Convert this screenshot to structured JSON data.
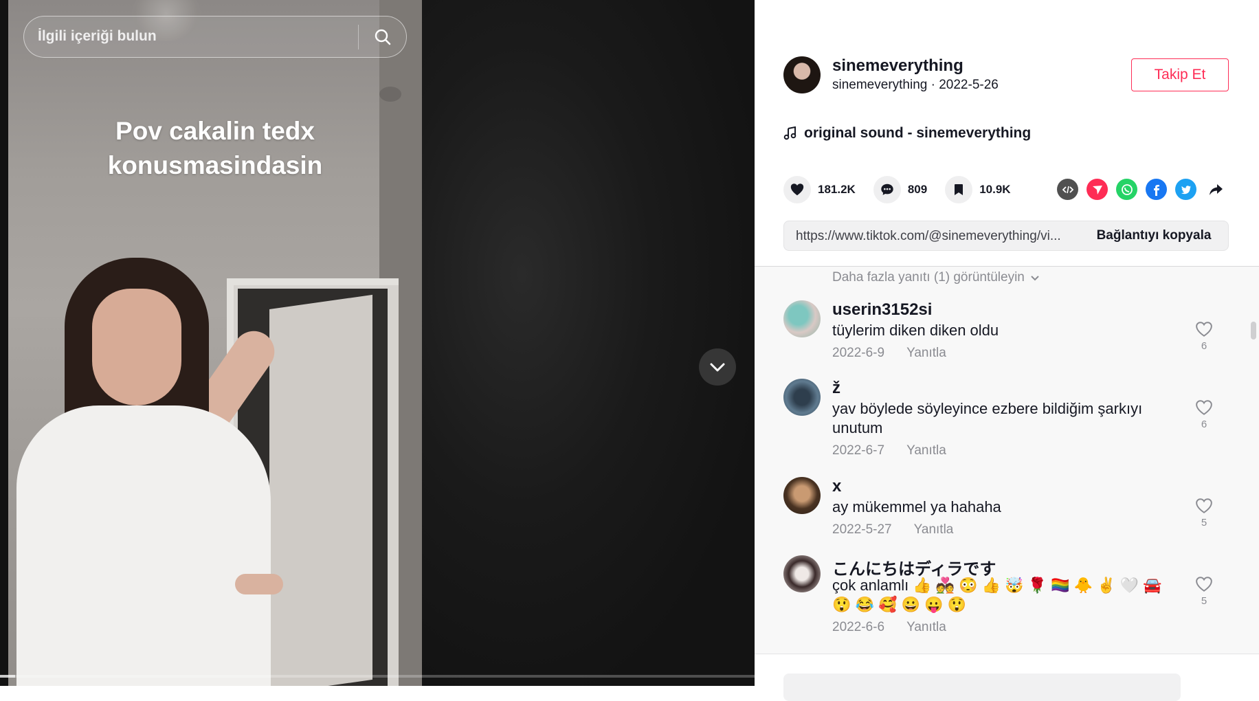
{
  "search": {
    "placeholder": "İlgili içeriği bulun"
  },
  "video": {
    "caption": "Pov cakalin tedx konusmasindasin",
    "progress": 0.02
  },
  "author": {
    "username": "sinemeverything",
    "display_name": "sinemeverything",
    "date": "2022-5-26",
    "meta_separator": " · "
  },
  "follow_label": "Takip Et",
  "sound": {
    "label": "original sound - sinemeverything"
  },
  "actions": {
    "likes": "181.2K",
    "comments": "809",
    "bookmarks": "10.9K"
  },
  "share_icons": [
    "embed-icon",
    "send-icon",
    "whatsapp-icon",
    "facebook-icon",
    "twitter-icon",
    "share-arrow-icon"
  ],
  "link": {
    "url": "https://www.tiktok.com/@sinemeverything/vi...",
    "copy_label": "Bağlantıyı kopyala"
  },
  "comments": {
    "more_replies": "Daha fazla yanıtı (1) görüntüleyin",
    "reply_label": "Yanıtla",
    "items": [
      {
        "user": "userin3152si",
        "text": "tüylerim diken diken oldu",
        "date": "2022-6-9",
        "likes": "6"
      },
      {
        "user": "ž",
        "text": "yav böylede söyleyince ezbere bildiğim şarkıyı unutum",
        "date": "2022-6-7",
        "likes": "6"
      },
      {
        "user": "x",
        "text": "ay mükemmel ya hahaha",
        "date": "2022-5-27",
        "likes": "5"
      },
      {
        "user": "こんにちはディラです",
        "text": "çok anlamlı 👍 💑 😳 👍 🤯 🌹 🏳️‍🌈 🐥 ✌️ 🤍 🚘 😲 😂 🥰 😀 😛 😲",
        "date": "2022-6-6",
        "likes": "5"
      }
    ]
  },
  "colors": {
    "accent": "#fe2c55",
    "text": "#161823",
    "muted": "#8a8b91"
  }
}
